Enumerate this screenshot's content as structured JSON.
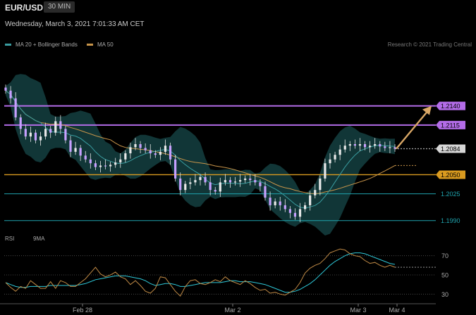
{
  "header": {
    "pair": "EUR/USD",
    "timeframe": "30 MIN",
    "datetime": "Wednesday, March 3, 2021 7:01:33 AM CET"
  },
  "legend": {
    "ma20_label": "MA 20 + Bollinger Bands",
    "ma50_label": "MA 50",
    "research": "Research © 2021 Trading Central"
  },
  "rsi_legend": {
    "rsi_label": "RSI",
    "ma_label": "9MA"
  },
  "colors": {
    "background": "#000000",
    "candle": "#e8e8e8",
    "bollinger_band": "#17484a",
    "ma20": "#3a9da0",
    "ma50": "#c8954a",
    "resistance": "#b36ce8",
    "support": "#d99a1f",
    "cyan_level": "#1fa3ad",
    "arrow": "#d9a766",
    "rsi": "#c08a45",
    "rsi_ma": "#2ec8d8"
  },
  "chart_data": {
    "type": "candlestick",
    "x_ticks": [
      "Feb 28",
      "Mar 2",
      "Mar 3",
      "Mar 4"
    ],
    "ylim": [
      1.1975,
      1.2205
    ],
    "current_price": 1.2084,
    "levels": [
      {
        "value": 1.214,
        "label": "1.2140",
        "kind": "resistance"
      },
      {
        "value": 1.2115,
        "label": "1.2115",
        "kind": "resistance"
      },
      {
        "value": 1.2084,
        "label": "1.2084",
        "kind": "current"
      },
      {
        "value": 1.205,
        "label": "1.2050",
        "kind": "support"
      },
      {
        "value": 1.2025,
        "label": "1.2025",
        "kind": "level"
      },
      {
        "value": 1.199,
        "label": "1.1990",
        "kind": "level"
      }
    ],
    "projection": {
      "from": 1.2084,
      "to": 1.214
    },
    "closes": [
      1.216,
      1.215,
      1.2125,
      1.211,
      1.21,
      1.2105,
      1.2095,
      1.21,
      1.211,
      1.2105,
      1.212,
      1.211,
      1.2095,
      1.208,
      1.2085,
      1.2075,
      1.207,
      1.2065,
      1.206,
      1.2062,
      1.2061,
      1.2063,
      1.2066,
      1.207,
      1.2078,
      1.2086,
      1.209,
      1.2085,
      1.2082,
      1.2078,
      1.2076,
      1.208,
      1.2088,
      1.207,
      1.2045,
      1.203,
      1.2038,
      1.204,
      1.2043,
      1.2047,
      1.204,
      1.203,
      1.2028,
      1.204,
      1.2043,
      1.204,
      1.2041,
      1.2043,
      1.2045,
      1.2043,
      1.204,
      1.2035,
      1.202,
      1.201,
      1.2015,
      1.201,
      1.2005,
      1.2,
      1.1995,
      1.2005,
      1.201,
      1.2023,
      1.203,
      1.2045,
      1.2065,
      1.207,
      1.2076,
      1.2083,
      1.2088,
      1.209,
      1.2088,
      1.209,
      1.2086,
      1.2088,
      1.209,
      1.2087,
      1.2085,
      1.2086,
      1.2084
    ],
    "rsi": {
      "yticks": [
        30,
        50,
        70
      ],
      "ylim": [
        20,
        80
      ],
      "last_value": 58,
      "values": [
        42,
        37,
        33,
        38,
        36,
        44,
        40,
        36,
        36,
        43,
        36,
        44,
        42,
        38,
        38,
        42,
        46,
        52,
        58,
        51,
        48,
        50,
        53,
        48,
        46,
        40,
        44,
        39,
        33,
        31,
        36,
        48,
        47,
        40,
        33,
        28,
        38,
        44,
        45,
        41,
        40,
        42,
        45,
        43,
        48,
        44,
        42,
        40,
        44,
        41,
        37,
        34,
        35,
        31,
        32,
        30,
        29,
        32,
        35,
        42,
        52,
        57,
        60,
        62,
        67,
        73,
        75,
        77,
        76,
        72,
        70,
        69,
        65,
        62,
        63,
        60,
        58,
        60,
        58
      ],
      "ma_values": [
        42,
        40,
        38,
        37,
        37,
        38,
        38,
        38,
        38,
        39,
        39,
        39,
        39,
        39,
        39,
        40,
        41,
        43,
        45,
        46,
        47,
        48,
        49,
        49,
        49,
        48,
        47,
        46,
        44,
        41,
        39,
        40,
        41,
        41,
        40,
        38,
        38,
        39,
        40,
        41,
        42,
        42,
        42,
        42,
        43,
        44,
        44,
        43,
        43,
        43,
        42,
        41,
        40,
        38,
        36,
        34,
        32,
        32,
        33,
        35,
        38,
        41,
        45,
        50,
        55,
        60,
        64,
        67,
        70,
        72,
        73,
        73,
        72,
        70,
        68,
        66,
        64,
        62,
        61
      ]
    }
  }
}
